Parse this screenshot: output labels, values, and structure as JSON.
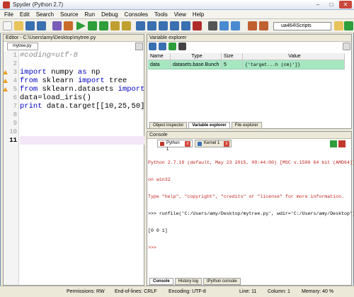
{
  "window": {
    "title": "Spyder (Python 2.7)"
  },
  "menu": [
    "File",
    "Edit",
    "Search",
    "Source",
    "Run",
    "Debug",
    "Consoles",
    "Tools",
    "View",
    "Help"
  ],
  "toolbar": {
    "path": "ua464\\Scripts"
  },
  "editor": {
    "title": "Editor - C:\\Users\\amy\\Desktop\\mytree.py",
    "tab": "mytree.py",
    "line_numbers": [
      "1",
      "2",
      "3",
      "4",
      "5",
      "6",
      "7",
      "8",
      "9",
      "10",
      "11"
    ],
    "lines": [
      {
        "text": "#coding=utf-8",
        "kind": "comment"
      },
      {
        "text": "",
        "kind": "plain"
      },
      {
        "text": "import numpy as np",
        "kind": "plain"
      },
      {
        "text": "from sklearn import tree",
        "kind": "plain"
      },
      {
        "text": "from sklearn.datasets import loa",
        "kind": "plain"
      },
      {
        "text": "data=load_iris()",
        "kind": "plain"
      },
      {
        "text": "print data.target[[10,25,50]]",
        "kind": "plain"
      },
      {
        "text": "",
        "kind": "plain"
      },
      {
        "text": "",
        "kind": "plain"
      },
      {
        "text": "",
        "kind": "plain"
      },
      {
        "text": "",
        "kind": "plain"
      }
    ],
    "current_line": "11"
  },
  "variable_explorer": {
    "title": "Variable explorer",
    "columns": [
      "Name",
      "Type",
      "Size",
      "Value"
    ],
    "rows": [
      {
        "name": "data",
        "type": "datasets.base.Bunch",
        "size": "5",
        "value": "{'target...h (cm)']}"
      }
    ],
    "tabs": [
      "Object inspector",
      "Variable explorer",
      "File explorer"
    ]
  },
  "console": {
    "title": "Console",
    "tabs": [
      "Python 1",
      "Kernel 1"
    ],
    "output": [
      {
        "text": "Python 2.7.10 (default, May 23 2015, 09:44:00) [MSC v.1500 64 bit (AMD64)]",
        "color": "red"
      },
      {
        "text": "on win32",
        "color": "red"
      },
      {
        "text": "Type \"help\", \"copyright\", \"credits\" or \"license\" for more information.",
        "color": "red"
      },
      {
        "text": ">>> runfile('C:/Users/amy/Desktop/mytree.py', wdir='C:/Users/amy/Desktop')",
        "color": "black"
      },
      {
        "text": "[0 0 1]",
        "color": "black"
      },
      {
        "text": ">>>",
        "color": "red"
      }
    ],
    "bottom_tabs": [
      "Console",
      "History log",
      "IPython console"
    ]
  },
  "status": {
    "permissions": "Permissions: RW",
    "eol": "End-of-lines: CRLF",
    "encoding": "Encoding: UTF-8",
    "line": "Line: 11",
    "column": "Column: 1",
    "memory": "Memory: 40 %"
  }
}
